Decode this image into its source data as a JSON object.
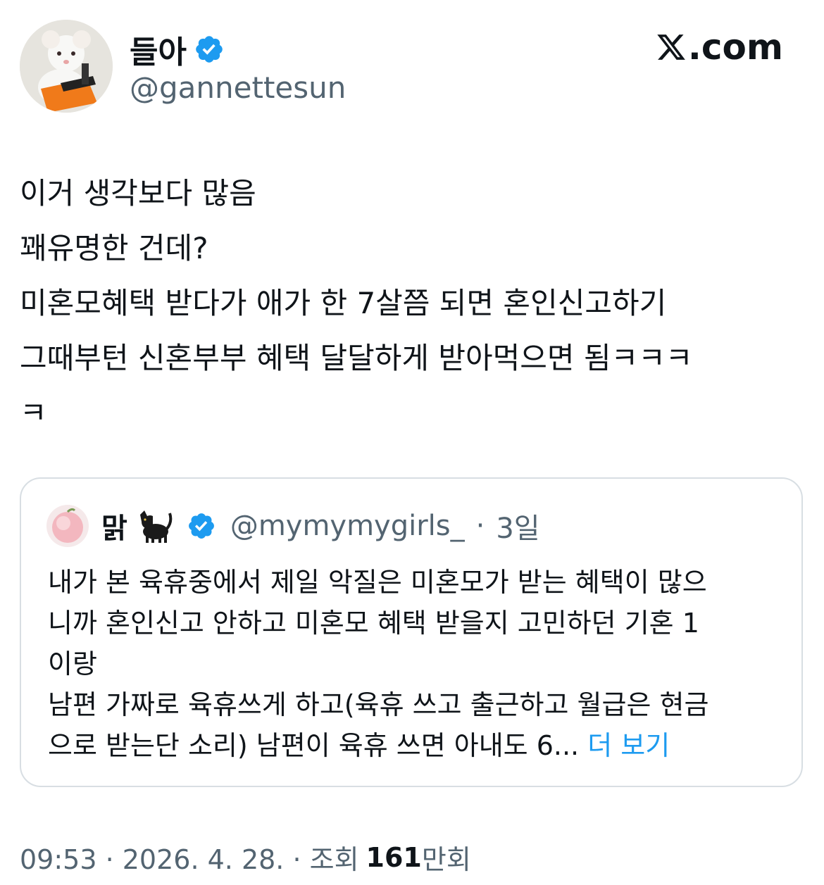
{
  "author": {
    "name": "들아",
    "handle": "@gannettesun",
    "avatar_icon": "mouse-with-orange-bag-avatar",
    "verified_color": "#1d9bf0"
  },
  "site": {
    "logo_text": ".com",
    "logo_icon": "x-logo-icon"
  },
  "tweet": {
    "text": "이거 생각보다 많음\n꽤유명한 건데?\n미혼모혜택 받다가 애가 한 7살쯤 되면 혼인신고하기\n그때부턴 신혼부부 혜택 달달하게 받아먹으면 됨ㅋㅋㅋ\nㅋ"
  },
  "quote": {
    "name": "맑",
    "name_emoji_icon": "black-cat-icon",
    "avatar_icon": "peach-avatar",
    "handle": "@mymymygirls_",
    "separator": "·",
    "time": "3일",
    "text": "내가 본 육휴중에서 제일 악질은 미혼모가 받는 혜택이 많으\n니까 혼인신고 안하고 미혼모 혜택 받을지 고민하던 기혼 1\n이랑\n남편 가짜로 육휴쓰게 하고(육휴 쓰고 출근하고 월급은 현금\n으로 받는단 소리) 남편이 육휴 쓰면 아내도 6... ",
    "more_label": "더 보기",
    "link_color": "#1d9bf0"
  },
  "footer": {
    "timestamp": "09:53 · 2026. 4. 28. · 조회",
    "views_count": "161",
    "views_unit": "만회"
  }
}
